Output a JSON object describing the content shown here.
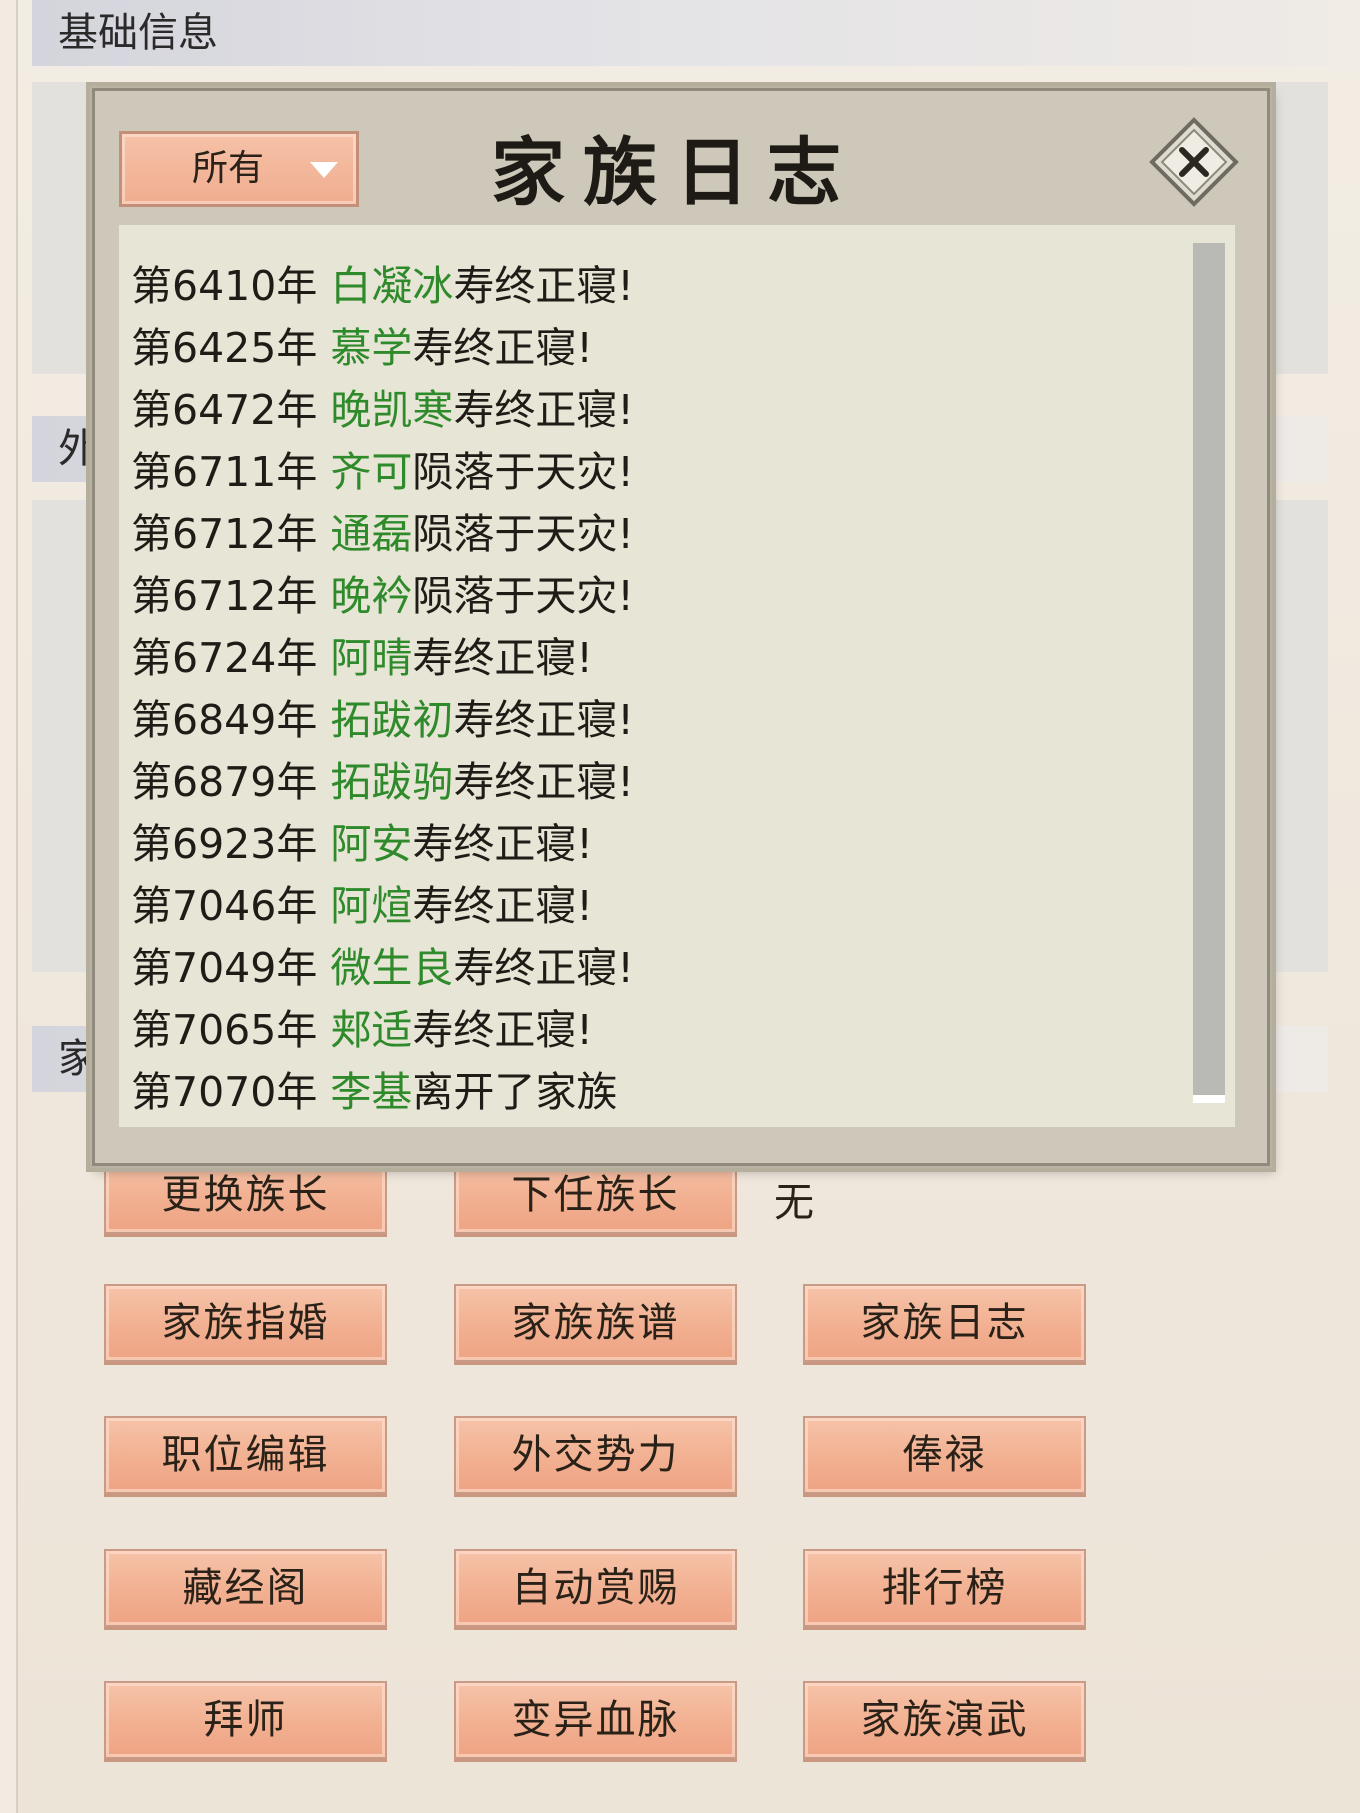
{
  "background_panel": {
    "section_basic_info": "基础信息",
    "section_diplomacy_partial": "外",
    "section_family_partial": "家",
    "next_leader_value": "无"
  },
  "buttons": {
    "change_leader": "更换族长",
    "next_leader": "下任族长",
    "arrange_marriage": "家族指婚",
    "family_tree": "家族族谱",
    "family_log": "家族日志",
    "position_edit": "职位编辑",
    "diplomatic_forces": "外交势力",
    "salary": "俸禄",
    "scripture_pavilion": "藏经阁",
    "auto_reward": "自动赏赐",
    "ranking": "排行榜",
    "apprentice": "拜师",
    "mutate_bloodline": "变异血脉",
    "family_martial_drill": "家族演武"
  },
  "modal": {
    "title": "家族日志",
    "filter_selected": "所有",
    "entries": [
      {
        "year": "第6410年",
        "name": "白凝冰",
        "event": "寿终正寝!"
      },
      {
        "year": "第6425年",
        "name": "慕学",
        "event": "寿终正寝!"
      },
      {
        "year": "第6472年",
        "name": "晚凯寒",
        "event": "寿终正寝!"
      },
      {
        "year": "第6711年",
        "name": "齐可",
        "event": "陨落于天灾!"
      },
      {
        "year": "第6712年",
        "name": "通磊",
        "event": "陨落于天灾!"
      },
      {
        "year": "第6712年",
        "name": "晚衿",
        "event": "陨落于天灾!"
      },
      {
        "year": "第6724年",
        "name": "阿晴",
        "event": "寿终正寝!"
      },
      {
        "year": "第6849年",
        "name": "拓跋初",
        "event": "寿终正寝!"
      },
      {
        "year": "第6879年",
        "name": "拓跋驹",
        "event": "寿终正寝!"
      },
      {
        "year": "第6923年",
        "name": "阿安",
        "event": "寿终正寝!"
      },
      {
        "year": "第7046年",
        "name": "阿煊",
        "event": "寿终正寝!"
      },
      {
        "year": "第7049年",
        "name": "微生良",
        "event": "寿终正寝!"
      },
      {
        "year": "第7065年",
        "name": "郏适",
        "event": "寿终正寝!"
      },
      {
        "year": "第7070年",
        "name": "李基",
        "event": "离开了家族"
      }
    ]
  },
  "colors": {
    "name_green": "#2e8a2a",
    "button_peach": "#f2b091",
    "modal_frame": "#cdc8b9",
    "log_background": "#e7e5d5"
  }
}
